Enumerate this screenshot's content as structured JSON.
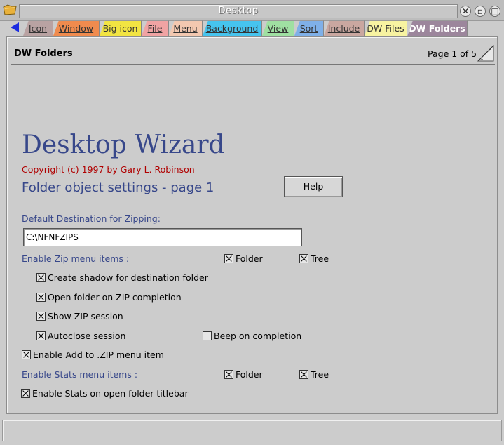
{
  "window": {
    "title": "Desktop"
  },
  "tabs": [
    {
      "label": "Icon",
      "color": "#b9a2a2"
    },
    {
      "label": "Window",
      "color": "#f08b4e"
    },
    {
      "label": "Big icon",
      "color": "#f2e442"
    },
    {
      "label": "File",
      "color": "#f0a3a3"
    },
    {
      "label": "Menu",
      "color": "#f3c8b0"
    },
    {
      "label": "Background",
      "color": "#46c4ee"
    },
    {
      "label": "View",
      "color": "#9fe0a2"
    },
    {
      "label": "Sort",
      "color": "#7fb0e8"
    },
    {
      "label": "Include",
      "color": "#caa7a0"
    },
    {
      "label": "DW Files",
      "color": "#f7f3a1"
    },
    {
      "label": "DW Folders",
      "color": "#9c869c",
      "active": true
    }
  ],
  "page": {
    "title": "DW Folders",
    "page_indicator": "Page 1 of 5"
  },
  "content": {
    "app_title": "Desktop Wizard",
    "copyright": "Copyright (c) 1997 by Gary L. Robinson",
    "subtitle": "Folder object settings - page 1",
    "help_label": "Help",
    "default_dest_label": "Default Destination for Zipping:",
    "default_dest_value": "C:\\NFNFZIPS",
    "zip_menu_label": "Enable Zip menu items :",
    "zip_folder": {
      "label": "Folder",
      "checked": true
    },
    "zip_tree": {
      "label": "Tree",
      "checked": true
    },
    "create_shadow": {
      "label": "Create shadow for destination folder",
      "checked": true
    },
    "open_folder": {
      "label": "Open folder on ZIP completion",
      "checked": true
    },
    "show_session": {
      "label": "Show ZIP session",
      "checked": true
    },
    "autoclose": {
      "label": "Autoclose session",
      "checked": true
    },
    "beep": {
      "label": "Beep on completion",
      "checked": false
    },
    "add_zip": {
      "label": "Enable Add to .ZIP menu item",
      "checked": true
    },
    "stats_menu_label": "Enable Stats menu items :",
    "stats_folder": {
      "label": "Folder",
      "checked": true
    },
    "stats_tree": {
      "label": "Tree",
      "checked": true
    },
    "stats_titlebar": {
      "label": "Enable Stats on open folder titlebar",
      "checked": true
    }
  }
}
